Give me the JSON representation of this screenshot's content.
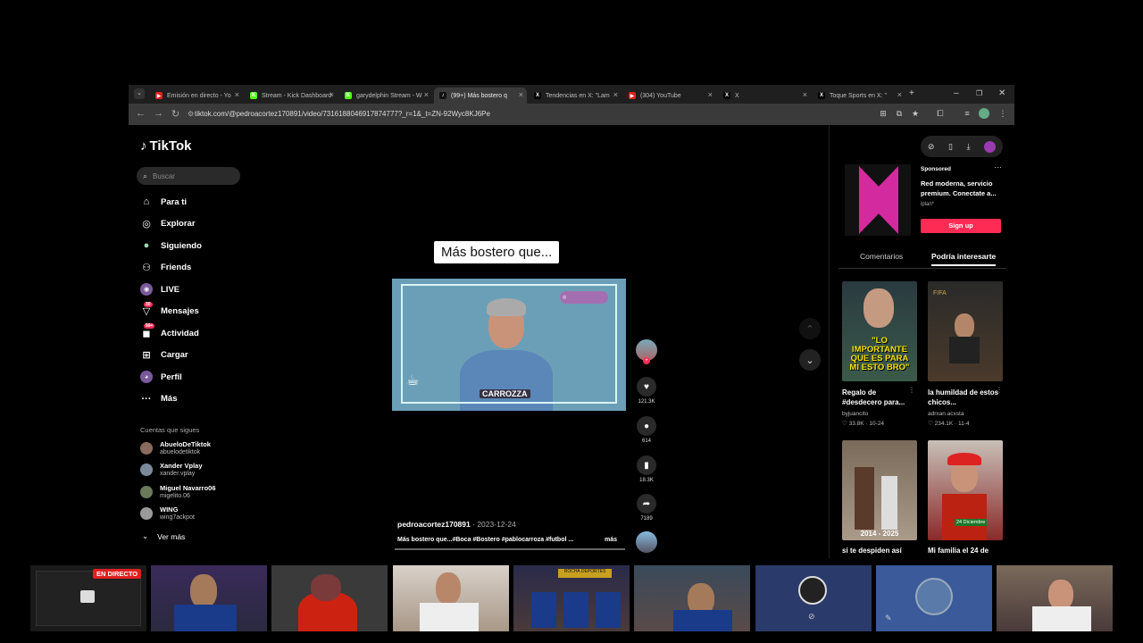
{
  "browser": {
    "tabs": [
      {
        "label": "Emisión en directo - Yo",
        "favicon_color": "#e02020",
        "favicon": "▶"
      },
      {
        "label": "Stream - Kick Dashboard",
        "favicon_color": "#53fc18",
        "favicon": "K"
      },
      {
        "label": "garydelphin Stream - W",
        "favicon_color": "#53fc18",
        "favicon": "K"
      },
      {
        "label": "(99+) Más bostero q",
        "favicon_color": "#111111",
        "favicon": "♪",
        "active": true
      },
      {
        "label": "Tendencias en X: \"Lam",
        "favicon_color": "#000000",
        "favicon": "X"
      },
      {
        "label": "(304) YouTube",
        "favicon_color": "#e02020",
        "favicon": "▶"
      },
      {
        "label": "X",
        "favicon_color": "#000000",
        "favicon": "X"
      },
      {
        "label": "Toque Sports en X: \"",
        "favicon_color": "#000000",
        "favicon": "X"
      }
    ],
    "url": "tiktok.com/@pedroacortez170891/video/7316188046917874777?_r=1&_t=ZN-92Wyc8KJ6Pe"
  },
  "tiktok": {
    "logo": "TikTok",
    "search_placeholder": "Buscar",
    "nav": [
      {
        "label": "Para ti",
        "icon": "home-icon"
      },
      {
        "label": "Explorar",
        "icon": "compass-icon"
      },
      {
        "label": "Siguiendo",
        "icon": "following-icon"
      },
      {
        "label": "Friends",
        "icon": "friends-icon"
      },
      {
        "label": "LIVE",
        "icon": "live-icon"
      },
      {
        "label": "Mensajes",
        "icon": "messages-icon",
        "badge": "30"
      },
      {
        "label": "Actividad",
        "icon": "activity-icon",
        "badge": "99+"
      },
      {
        "label": "Cargar",
        "icon": "upload-icon"
      },
      {
        "label": "Perfil",
        "icon": "profile-icon"
      },
      {
        "label": "Más",
        "icon": "more-icon"
      }
    ],
    "following_title": "Cuentas que sigues",
    "following": [
      {
        "name": "AbueloDeTiktok",
        "handle": "abuelodetiktok"
      },
      {
        "name": "Xander Vplay",
        "handle": "xander.vplay"
      },
      {
        "name": "Miguel Navarro06",
        "handle": "migelito.06"
      },
      {
        "name": "WING",
        "handle": "wing7ackpot"
      }
    ],
    "see_more": "Ver más",
    "video": {
      "caption": "Más bostero que...",
      "overlay_name": "CARROZZA",
      "author": "pedroacortez170891",
      "date": "2023-12-24",
      "description": "Más bostero que...#Boca #Bostero #pablocarroza #futbol ...",
      "more": "más",
      "likes": "121.3K",
      "comments": "614",
      "saves": "18.3K",
      "shares": "7189"
    },
    "ad": {
      "sponsored": "Sponsored",
      "text": "Red moderna, servicio premium. Conectate a...",
      "source": "iplan*",
      "button": "Sign up"
    },
    "tabs": {
      "comments": "Comentarios",
      "recommended": "Podría interesarte"
    },
    "recommended": [
      {
        "title": "Regalo de #desdecero para...",
        "author": "byjuancito",
        "likes": "33.8K",
        "date": "10-24",
        "overlay": "\"LO IMPORTANTE QUE ES PARA MI ESTO BRO\""
      },
      {
        "title": "la humildad de estos chicos...",
        "author": "adrxan.acxsta",
        "likes": "234.1K",
        "date": "11-4"
      },
      {
        "title": "si te despiden así",
        "overlay": "2014 - 2025"
      },
      {
        "title": "Mi familia el 24 de",
        "overlay": "24 Diciembre"
      }
    ]
  },
  "stream_strip": {
    "live_label": "EN DIRECTO"
  }
}
